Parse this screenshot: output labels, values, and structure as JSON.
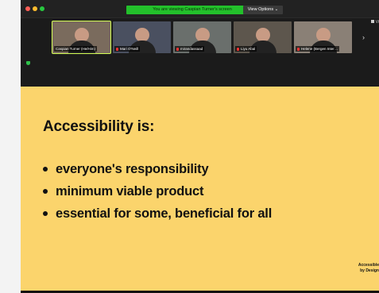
{
  "window": {
    "share_banner": "You are viewing Caspian Turner's screen",
    "view_options_label": "View Options ⌄",
    "view_mode_label": "Vi"
  },
  "participants": [
    {
      "name": "Caspian Turner (He/Him)",
      "bg": "#7a6b5d",
      "muted": false,
      "active": true
    },
    {
      "name": "Mari O'Neill",
      "bg": "#4a5060",
      "muted": true,
      "active": false
    },
    {
      "name": "mirandassaad",
      "bg": "#6a6f6c",
      "muted": true,
      "active": false
    },
    {
      "name": "Liyu Abal",
      "bg": "#5d564d",
      "muted": true,
      "active": false
    },
    {
      "name": "Helene (Bergen Inter…",
      "bg": "#8a8076",
      "muted": true,
      "active": false
    }
  ],
  "slide": {
    "title": "Accessibility is:",
    "bullets": [
      "everyone's responsibility",
      "minimum viable product",
      "essential for some, beneficial for all"
    ],
    "brand_line1": "Accessible",
    "brand_line2": "by Design"
  },
  "colors": {
    "slide_bg": "#fbd46c",
    "share_green": "#23c02b",
    "active_speaker": "#d4ff56"
  }
}
